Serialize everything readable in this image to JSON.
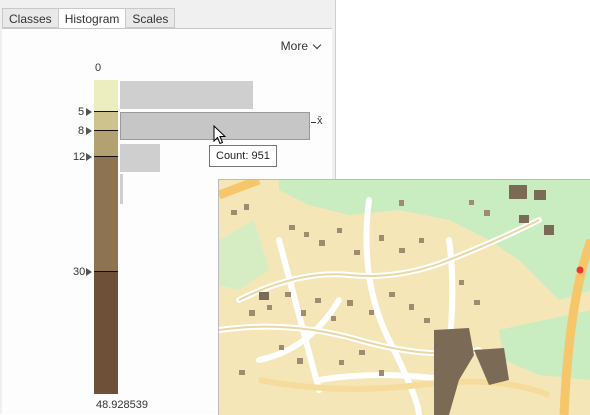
{
  "tabs": [
    {
      "label": "Classes",
      "active": false
    },
    {
      "label": "Histogram",
      "active": true
    },
    {
      "label": "Scales",
      "active": false
    }
  ],
  "more_menu": {
    "label": "More"
  },
  "histogram": {
    "min_label": "0",
    "max_label": "48.928539",
    "break_labels": [
      "5",
      "8",
      "12",
      "30"
    ],
    "mean_symbol": "x̄",
    "tooltip": "Count: 951",
    "class_colors": [
      "#eceec0",
      "#cec38c",
      "#b4a171",
      "#8e7352",
      "#6e5038"
    ]
  },
  "map": {
    "colors": {
      "land": "#f5e6b8",
      "park": "#c9ecc0",
      "building": "#7b6a55",
      "road": "#ffffff",
      "highway": "#f6c76a"
    }
  }
}
